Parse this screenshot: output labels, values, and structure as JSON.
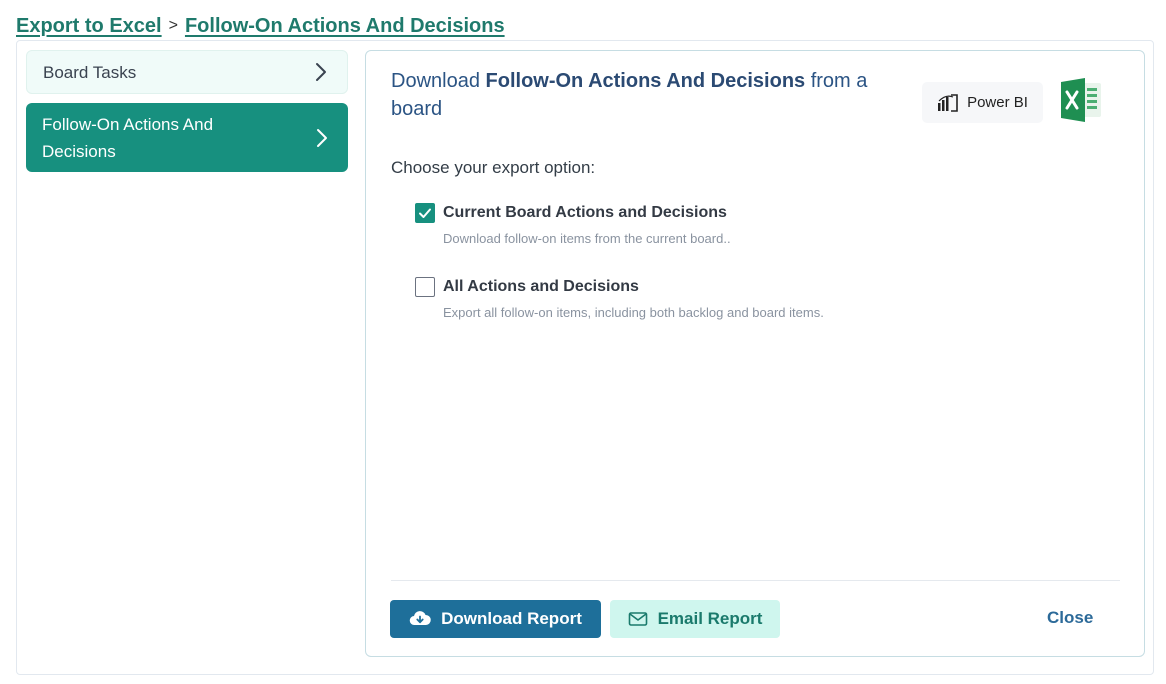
{
  "breadcrumb": {
    "root": "Export to Excel",
    "separator": ">",
    "current": "Follow-On Actions And Decisions"
  },
  "sidebar": {
    "items": [
      {
        "label": "Board Tasks",
        "active": false
      },
      {
        "label": "Follow-On Actions And Decisions",
        "active": true
      }
    ]
  },
  "panel": {
    "title_prefix": "Download",
    "title_bold": "Follow-On Actions And Decisions",
    "title_suffix": "from a board",
    "powerbi_label": "Power BI",
    "prompt": "Choose your export option:",
    "options": [
      {
        "label": "Current Board Actions and Decisions",
        "description": "Download follow-on items from the current board..",
        "checked": true
      },
      {
        "label": "All Actions and Decisions",
        "description": "Export all follow-on items, including both backlog and board items.",
        "checked": false
      }
    ]
  },
  "footer": {
    "download_label": "Download Report",
    "email_label": "Email Report",
    "close_label": "Close"
  },
  "colors": {
    "accent": "#17907f",
    "primary_button": "#1e6f9a",
    "secondary_button": "#cff6ee",
    "title": "#2b5484"
  },
  "icons": {
    "nav_chevron": "chevron-right-icon",
    "powerbi": "powerbi-icon",
    "excel": "excel-icon",
    "download": "cloud-download-icon",
    "email": "envelope-icon",
    "checkbox": "checkmark-icon"
  }
}
